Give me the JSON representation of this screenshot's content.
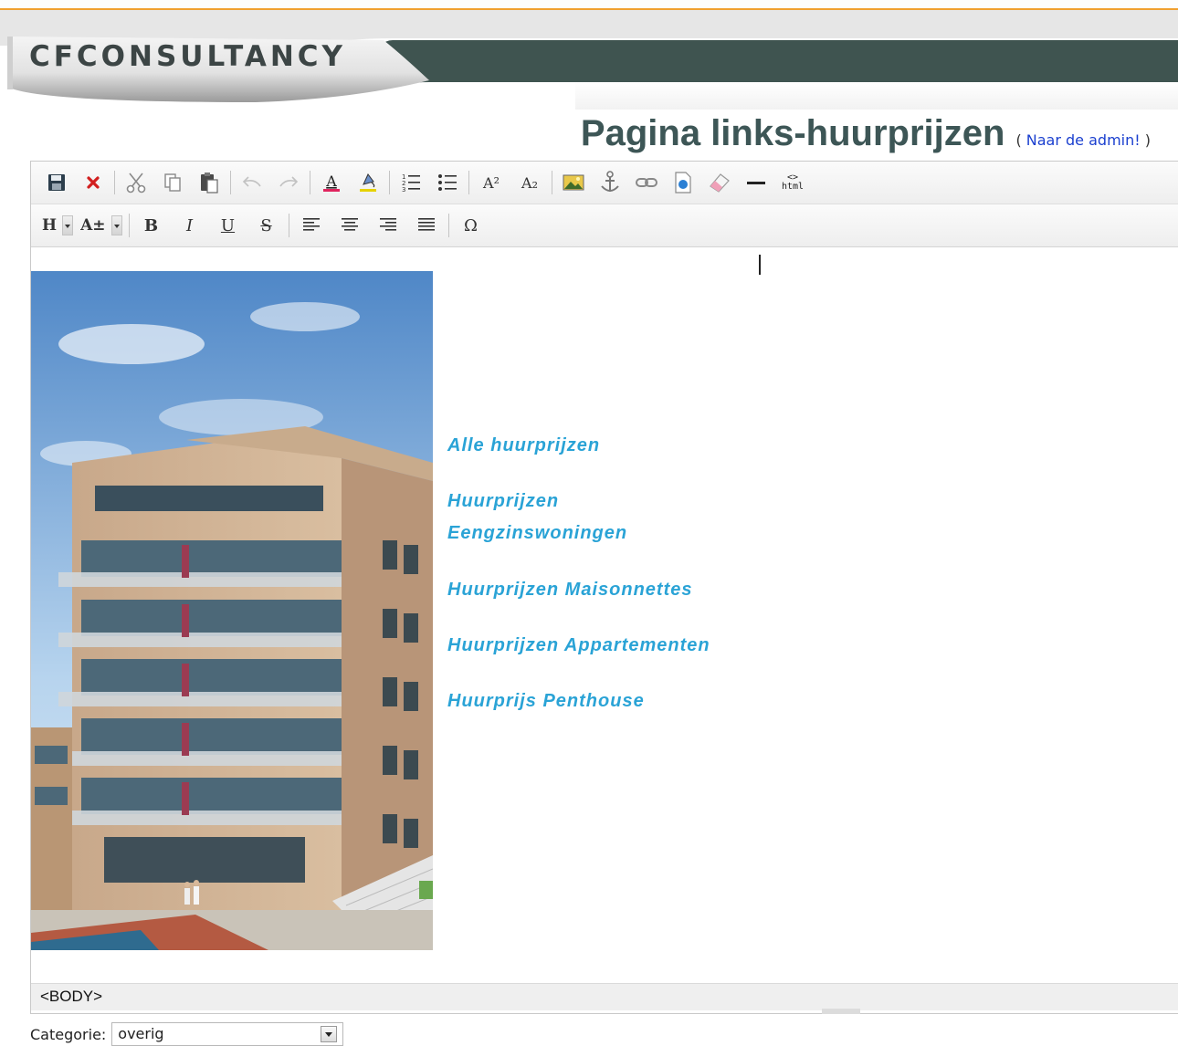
{
  "header": {
    "logo_text": "CFCONSULTANCY"
  },
  "page": {
    "title": "Pagina links-huurprijzen",
    "admin_open": "(",
    "admin_link": "Naar de admin!",
    "admin_close": ")"
  },
  "toolbar1": {
    "buttons": [
      "save-icon",
      "cancel-icon",
      "cut-icon",
      "copy-icon",
      "paste-icon",
      "undo-icon",
      "redo-icon",
      "font-color-icon",
      "highlight-color-icon",
      "ordered-list-icon",
      "unordered-list-icon",
      "superscript-icon",
      "subscript-icon",
      "image-icon",
      "anchor-icon",
      "link-icon",
      "document-icon",
      "eraser-icon",
      "horizontal-rule-icon",
      "html-source-icon"
    ],
    "superscript_label": "A²",
    "subscript_label": "A₂",
    "html_label_top": "<>",
    "html_label_bottom": "html"
  },
  "toolbar2": {
    "heading_label": "H",
    "fontsize_label": "A±",
    "bold_label": "B",
    "italic_label": "I",
    "underline_label": "U",
    "strike_label": "S",
    "special_char_label": "Ω"
  },
  "content": {
    "links": [
      "Alle huurprijzen",
      "Huurprijzen Eengzinswoningen",
      "Huurprijzen Maisonnettes",
      "Huurprijzen Appartementen",
      "Huurprijs Penthouse"
    ]
  },
  "statusbar": {
    "path": "<BODY>"
  },
  "category": {
    "label": "Categorie:",
    "value": "overig"
  },
  "colors": {
    "link": "#2aa3d6",
    "title": "#3d5656",
    "banner_dark": "#3f5450",
    "accent_line": "#f0a030"
  }
}
